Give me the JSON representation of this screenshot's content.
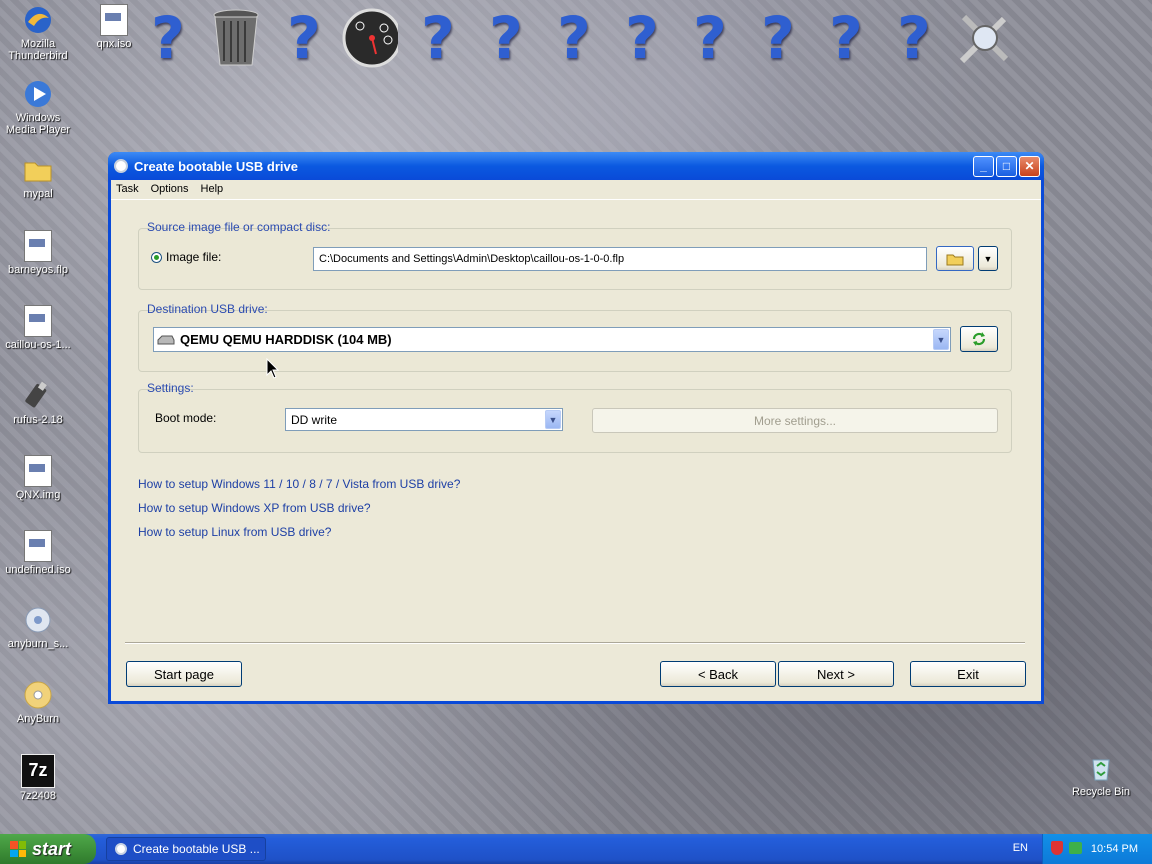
{
  "desktop": {
    "icons": [
      {
        "label": "Mozilla Thunderbird"
      },
      {
        "label": "qnx.iso"
      },
      {
        "label": "Windows Media Player"
      },
      {
        "label": "mypal"
      },
      {
        "label": "barneyos.flp"
      },
      {
        "label": "caillou-os-1..."
      },
      {
        "label": "rufus-2.18"
      },
      {
        "label": "QNX.img"
      },
      {
        "label": "undefined.iso"
      },
      {
        "label": "anyburn_s..."
      },
      {
        "label": "AnyBurn"
      },
      {
        "label": "7z2408"
      },
      {
        "label": "Recycle Bin"
      }
    ],
    "seven_zip_badge": "7z"
  },
  "dock": {
    "question_glyph": "?"
  },
  "window": {
    "title": "Create bootable USB drive",
    "menu": [
      "Task",
      "Options",
      "Help"
    ],
    "source": {
      "group_label": "Source image file or compact disc:",
      "radio_label": "Image file:",
      "path": "C:\\Documents and Settings\\Admin\\Desktop\\caillou-os-1-0-0.flp"
    },
    "destination": {
      "group_label": "Destination USB drive:",
      "drive": "QEMU QEMU HARDDISK (104 MB)"
    },
    "settings": {
      "group_label": "Settings:",
      "boot_mode_label": "Boot mode:",
      "boot_mode": "DD write",
      "more_settings": "More settings..."
    },
    "links": [
      "How to setup Windows 11 / 10 / 8 / 7 / Vista from USB drive?",
      "How to setup Windows XP from USB drive?",
      "How to setup Linux from USB drive?"
    ],
    "buttons": {
      "start_page": "Start page",
      "back": "< Back",
      "next": "Next >",
      "exit": "Exit"
    }
  },
  "taskbar": {
    "start": "start",
    "task": "Create bootable USB ...",
    "lang": "EN",
    "clock": "10:54 PM"
  },
  "colors": {
    "accent": "#0a4ad8",
    "link": "#1d3fa5",
    "group_label": "#2b4bb0"
  }
}
